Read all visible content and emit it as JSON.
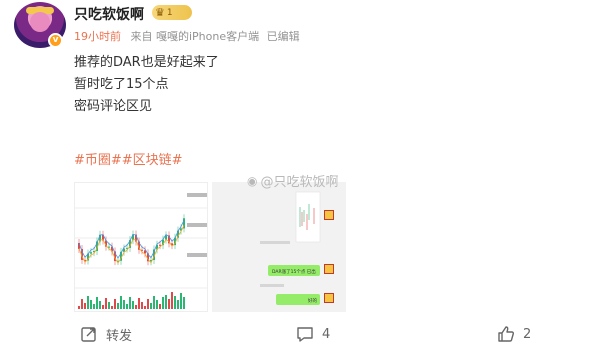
{
  "user": {
    "name": "只吃软饭啊",
    "level": "1",
    "verified_mark": "v"
  },
  "meta": {
    "time": "19小时前",
    "source": "来自 嘎嘎的iPhone客户端",
    "edited": "已编辑"
  },
  "post": {
    "lines": [
      "推荐的DAR也是好起来了",
      "暂时吃了15个点",
      "密码评论区见"
    ],
    "tags": "#币圈##区块链#"
  },
  "watermark": {
    "icon": "weibo-icon",
    "text": "@只吃软饭啊"
  },
  "chat": {
    "bubble1": "DAR涨了15个点 已出",
    "bubble2": "好的"
  },
  "actions": {
    "repost_label": "转发",
    "comment_count": "4",
    "like_count": "2"
  },
  "colors": {
    "accent": "#eb7350",
    "bull": "#2bb673",
    "bear": "#e0494b",
    "chat_green": "#95ec69"
  }
}
